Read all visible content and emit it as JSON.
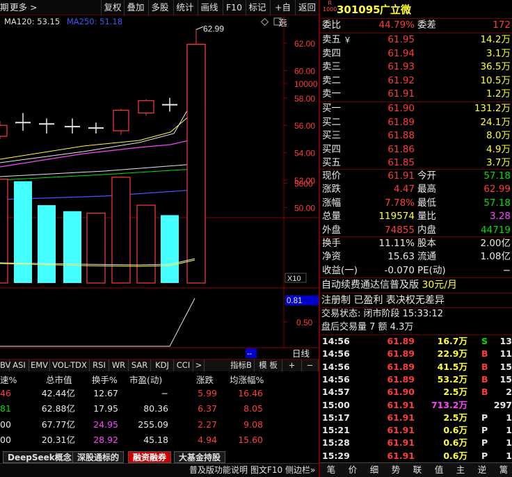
{
  "toolbar": {
    "items": [
      "期",
      "更多 >",
      "复权",
      "叠加",
      "多股",
      "统计",
      "画线",
      "F10",
      "标记",
      "+自选",
      "返回"
    ]
  },
  "ma_legend": {
    "ma120": "MA120: 53.15",
    "ma250": "MA250: 51.18",
    "ma120_color": "#e0e0e0",
    "ma250_color": "#4455ff"
  },
  "price_chart": {
    "ylabels": [
      "62.00",
      "60.00",
      "58.00",
      "56.00",
      "54.00",
      "52.00",
      "50.00"
    ],
    "yvalues": [
      62,
      60,
      58,
      56,
      54,
      52,
      50
    ],
    "high_label": "62.99",
    "candles": [
      {
        "o": 55.2,
        "c": 56.0,
        "h": 56.3,
        "l": 55.0,
        "up": true
      },
      {
        "o": 56.1,
        "c": 56.2,
        "h": 56.9,
        "l": 55.6,
        "up": false,
        "doji": true
      },
      {
        "o": 56.0,
        "c": 56.1,
        "h": 56.5,
        "l": 55.4,
        "up": false,
        "doji": true
      },
      {
        "o": 55.8,
        "c": 55.9,
        "h": 56.5,
        "l": 55.4,
        "up": false,
        "doji": true
      },
      {
        "o": 55.7,
        "c": 55.8,
        "h": 56.2,
        "l": 55.4,
        "up": false,
        "doji": true
      },
      {
        "o": 55.6,
        "c": 57.1,
        "h": 57.2,
        "l": 55.3,
        "up": true
      },
      {
        "o": 56.9,
        "c": 57.8,
        "h": 57.9,
        "l": 56.7,
        "up": true
      },
      {
        "o": 57.4,
        "c": 57.5,
        "h": 58.0,
        "l": 57.0,
        "up": false,
        "doji": true
      },
      {
        "o": 57.2,
        "c": 61.91,
        "h": 62.99,
        "l": 57.2,
        "up": true
      }
    ]
  },
  "volume_chart": {
    "ylabels": [
      "10000",
      "5000"
    ],
    "bars": [
      {
        "v": 5200,
        "color": "red"
      },
      {
        "v": 5100,
        "color": "cyan"
      },
      {
        "v": 3900,
        "color": "cyan"
      },
      {
        "v": 3600,
        "color": "cyan"
      },
      {
        "v": 3500,
        "color": "red"
      },
      {
        "v": 5300,
        "color": "red"
      },
      {
        "v": 3900,
        "color": "red"
      },
      {
        "v": 3400,
        "color": "cyan"
      },
      {
        "v": 11957,
        "color": "red"
      }
    ],
    "x10_label": "X10"
  },
  "indicator_chart": {
    "value_label": "0.81",
    "ylabel": "0.50",
    "dash_label": "--",
    "period_label": "日线"
  },
  "colbar": {
    "items": [
      "BV",
      "ASI",
      "EMV",
      "VOL-TDX",
      "RSI",
      "WR",
      "SAR",
      "KDJ",
      "CCI",
      ">",
      "指标B",
      "模 板",
      "+",
      "−"
    ]
  },
  "table": {
    "headers": [
      "速%",
      "总市值",
      "换手%",
      "市盈(动)",
      "涨跌",
      "均涨幅%"
    ],
    "rows": [
      {
        "c0": "46",
        "c1": "42.44亿",
        "c2": "12.67",
        "c3": "−",
        "c4": "5.99",
        "c5": "16.46",
        "c0color": "red",
        "c2color": "white"
      },
      {
        "c0": "81",
        "c1": "62.88亿",
        "c2": "17.95",
        "c3": "80.36",
        "c4": "6.37",
        "c5": "8.05",
        "c0color": "green",
        "c2color": "white"
      },
      {
        "c0": "00",
        "c1": "67.77亿",
        "c2": "24.95",
        "c3": "255.09",
        "c4": "2.27",
        "c5": "9.08",
        "c0color": "white",
        "c2color": "magenta"
      },
      {
        "c0": "00",
        "c1": "20.31亿",
        "c2": "28.92",
        "c3": "45.18",
        "c4": "4.94",
        "c5": "15.60",
        "c0color": "white",
        "c2color": "magenta"
      }
    ]
  },
  "tabs": [
    "DeepSeek概念",
    "深股通标的",
    "融资融券",
    "大基金持股"
  ],
  "active_tab": "融资融券",
  "statusbar": {
    "a": "普及版功能说明",
    "b": "图文F10",
    "c": "侧边栏»"
  },
  "quote": {
    "badge_top": "R",
    "badge_bottom": "1000",
    "code": "301095",
    "name": "广立微",
    "weibi_label": "委比",
    "weibi": "44.79%",
    "weicha_label": "委差",
    "weicha": "172",
    "asks": [
      {
        "label": "卖五",
        "flag": "￥",
        "price": "61.95",
        "vol": "14.2万"
      },
      {
        "label": "卖四",
        "flag": "",
        "price": "61.94",
        "vol": "3.1万"
      },
      {
        "label": "卖三",
        "flag": "",
        "price": "61.93",
        "vol": "36.5万"
      },
      {
        "label": "卖二",
        "flag": "",
        "price": "61.92",
        "vol": "10.5万"
      },
      {
        "label": "卖一",
        "flag": "",
        "price": "61.91",
        "vol": "1.2万"
      }
    ],
    "bids": [
      {
        "label": "买一",
        "price": "61.90",
        "vol": "131.2万"
      },
      {
        "label": "买二",
        "price": "61.89",
        "vol": "24.1万"
      },
      {
        "label": "买三",
        "price": "61.88",
        "vol": "8.0万"
      },
      {
        "label": "买四",
        "price": "61.86",
        "vol": "4.9万"
      },
      {
        "label": "买五",
        "price": "61.85",
        "vol": "3.7万"
      }
    ],
    "stats": [
      {
        "l1": "现价",
        "v1": "61.91",
        "c1": "red",
        "l2": "今开",
        "v2": "57.18",
        "c2": "green"
      },
      {
        "l1": "涨跌",
        "v1": "4.47",
        "c1": "red",
        "l2": "最高",
        "v2": "62.99",
        "c2": "red"
      },
      {
        "l1": "涨幅",
        "v1": "7.78%",
        "c1": "red",
        "l2": "最低",
        "v2": "57.18",
        "c2": "green"
      },
      {
        "l1": "总量",
        "v1": "119574",
        "c1": "yellow",
        "l2": "量比",
        "v2": "3.28",
        "c2": "magenta"
      },
      {
        "l1": "外盘",
        "v1": "74855",
        "c1": "red",
        "l2": "内盘",
        "v2": "44719",
        "c2": "green"
      }
    ],
    "fundamentals": [
      {
        "l1": "换手",
        "v1": "11.11%",
        "l2": "股本",
        "v2": "2.00亿"
      },
      {
        "l1": "净资",
        "v1": "15.63",
        "l2": "流通",
        "v2": "1.08亿"
      },
      {
        "l1": "收益(一)",
        "v1": "-0.070",
        "l2": "PE(动)",
        "v2": "−"
      }
    ],
    "promo1_a": "自动续费通达信普及版 ",
    "promo1_b": "30元/月",
    "promo2": "注册制 已盈利 表决权无差异",
    "trade_status": "交易状态: 闭市阶段 15:33:12",
    "after_hours_a": "盘后交易量 7 额 4.3万"
  },
  "trades": [
    {
      "t": "14:56",
      "p": "61.89",
      "v": "16.7万",
      "bs": "S",
      "n": "13",
      "pc": "red",
      "vc": "yellow",
      "bsc": "green"
    },
    {
      "t": "14:56",
      "p": "61.89",
      "v": "22.9万",
      "bs": "B",
      "n": "11",
      "pc": "red",
      "vc": "yellow",
      "bsc": "red"
    },
    {
      "t": "14:56",
      "p": "61.89",
      "v": "41.5万",
      "bs": "B",
      "n": "15",
      "pc": "red",
      "vc": "yellow",
      "bsc": "red"
    },
    {
      "t": "14:56",
      "p": "61.89",
      "v": "53.2万",
      "bs": "B",
      "n": "15",
      "pc": "red",
      "vc": "yellow",
      "bsc": "red"
    },
    {
      "t": "14:57",
      "p": "61.90",
      "v": "2.5万",
      "bs": "B",
      "n": "2",
      "pc": "red",
      "vc": "yellow",
      "bsc": "red"
    },
    {
      "t": "15:00",
      "p": "61.91",
      "v": "713.2万",
      "bs": "",
      "n": "297",
      "pc": "red",
      "vc": "magenta",
      "bsc": "white"
    },
    {
      "t": "15:17",
      "p": "61.91",
      "v": "2.5万",
      "bs": "P",
      "n": "1",
      "pc": "red",
      "vc": "yellow",
      "bsc": "white"
    },
    {
      "t": "15:21",
      "p": "61.91",
      "v": "0.6万",
      "bs": "P",
      "n": "1",
      "pc": "red",
      "vc": "yellow",
      "bsc": "white"
    },
    {
      "t": "15:28",
      "p": "61.91",
      "v": "0.6万",
      "bs": "P",
      "n": "1",
      "pc": "red",
      "vc": "yellow",
      "bsc": "white"
    },
    {
      "t": "15:29",
      "p": "61.91",
      "v": "0.6万",
      "bs": "P",
      "n": "1",
      "pc": "red",
      "vc": "yellow",
      "bsc": "white"
    }
  ],
  "rtabs": [
    "笔",
    "价",
    "细",
    "势",
    "联",
    "值",
    "主",
    "逆",
    "篱"
  ]
}
